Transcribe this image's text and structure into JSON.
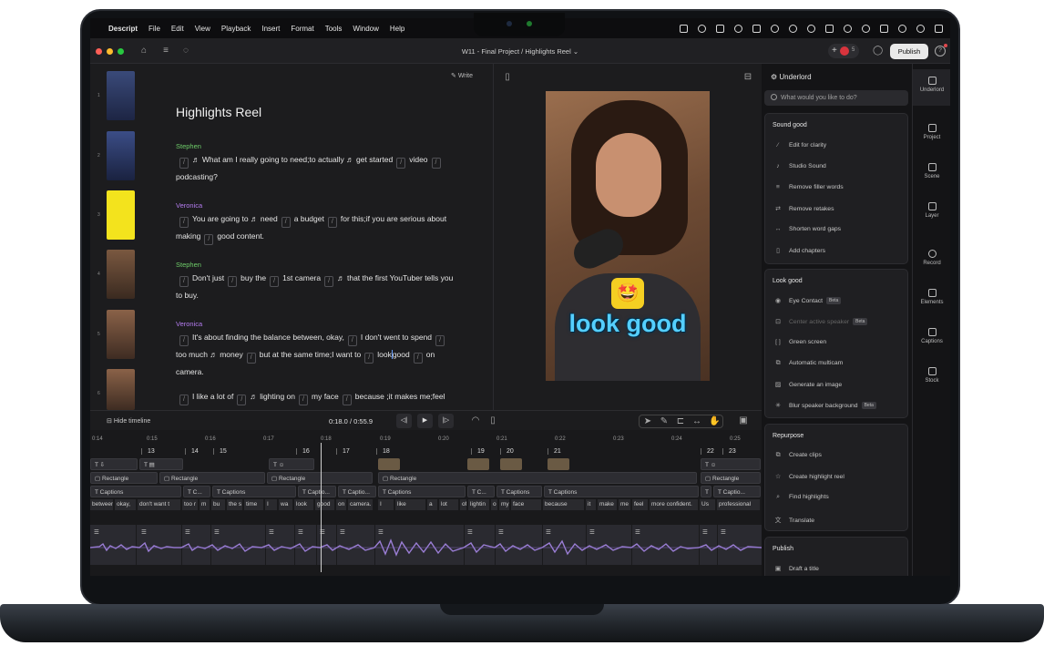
{
  "menubar": {
    "app": "Descript",
    "items": [
      "File",
      "Edit",
      "View",
      "Playback",
      "Insert",
      "Format",
      "Tools",
      "Window",
      "Help"
    ]
  },
  "titlebar": {
    "document": "W11 - Final Project",
    "separator": "/",
    "composition": "Highlights Reel",
    "collaborator_count": "5",
    "publish": "Publish",
    "help": "?"
  },
  "editor": {
    "title": "Highlights Reel",
    "write_label": "Write",
    "scene_numbers": [
      "1",
      "2",
      "3",
      "4",
      "5",
      "6"
    ],
    "blocks": [
      {
        "speaker": "Stephen",
        "lines": [
          "What am I really going to need;to actually",
          "get started",
          "video",
          "podcasting?"
        ]
      },
      {
        "speaker": "Veronica",
        "lines": [
          "You are going to",
          "need",
          "a budget",
          "for this;if you are serious about",
          "making",
          "good content."
        ]
      },
      {
        "speaker": "Stephen",
        "lines": [
          "Don't just",
          "buy the",
          "1st camera",
          "that the first YouTuber tells you",
          "to buy."
        ]
      },
      {
        "speaker": "Veronica",
        "lines": [
          "It's about finding the balance between, okay,",
          "I don't went to spend",
          "too much",
          "money",
          "but at the same time;I want to",
          "look",
          "good",
          "on",
          "camera."
        ]
      },
      {
        "speaker": "",
        "lines": [
          "I like a lot of",
          "lighting on",
          "my face",
          "because ;it makes me;feel"
        ]
      }
    ],
    "speaker_colors": {
      "Stephen": "#6fce6a",
      "Veronica": "#b47cf0"
    }
  },
  "preview": {
    "caption": "look good",
    "emoji": "🤩"
  },
  "transport": {
    "hide_timeline": "Hide timeline",
    "current_time": "0:18.0",
    "time_separator": "/",
    "total_time": "0:55.9"
  },
  "timeline": {
    "ruler": [
      "0:14",
      "0:15",
      "0:16",
      "0:17",
      "0:18",
      "0:19",
      "0:20",
      "0:21",
      "0:22",
      "0:23",
      "0:24",
      "0:25"
    ],
    "scenes": [
      "13",
      "14",
      "15",
      "16",
      "17",
      "18",
      "19",
      "20",
      "21",
      "22",
      "23"
    ],
    "rectangles": [
      "Rectangle",
      "Rectangle",
      "Rectangle",
      "Rectangle",
      "Rectangle"
    ],
    "captions": [
      "Captions",
      "C...",
      "Captions",
      "Captio...",
      "Captio...",
      "Captions",
      "C...",
      "Captions",
      "Captions",
      "Captio..."
    ],
    "words": [
      "between",
      "okay,",
      "don't want t",
      "too r",
      "m",
      "bu",
      "the s",
      "time",
      "I",
      "wa",
      "look",
      "good",
      "on",
      "camera.",
      "I",
      "like",
      "a",
      "lot",
      "of",
      "lightin",
      "o",
      "my",
      "face",
      "because",
      "it",
      "make",
      "me",
      "feel",
      "more confident.",
      "Us",
      "professional"
    ]
  },
  "sidebar": {
    "header": "Underlord",
    "ask_placeholder": "What would you like to do?",
    "sound_good": {
      "title": "Sound good",
      "items": [
        "Edit for clarity",
        "Studio Sound",
        "Remove filler words",
        "Remove retakes",
        "Shorten word gaps",
        "Add chapters"
      ]
    },
    "look_good": {
      "title": "Look good",
      "items": [
        "Eye Contact",
        "Center active speaker",
        "Green screen",
        "Automatic multicam",
        "Generate an image",
        "Blur speaker background"
      ],
      "beta": "Beta"
    },
    "repurpose": {
      "title": "Repurpose",
      "items": [
        "Create clips",
        "Create highlight reel",
        "Find highlights",
        "Translate"
      ]
    },
    "publish": {
      "title": "Publish",
      "items": [
        "Draft a title"
      ]
    }
  },
  "rail": {
    "items": [
      "Underlord",
      "Project",
      "Scene",
      "Layer",
      "Record",
      "Elements",
      "Captions",
      "Stock"
    ]
  }
}
